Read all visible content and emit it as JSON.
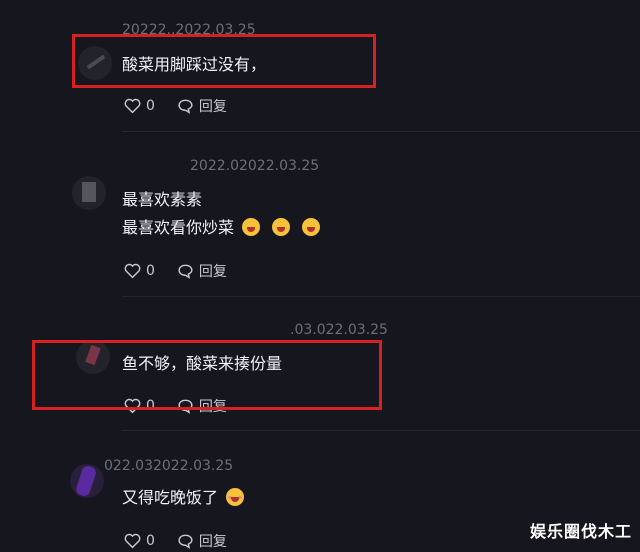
{
  "comments": [
    {
      "meta": "20222..2022.03.25",
      "lines": [
        "酸菜用脚踩过没有，"
      ],
      "likes": "0",
      "reply": "回复"
    },
    {
      "meta": "2022.02022.03.25",
      "lines": [
        "最喜欢素素",
        "最喜欢看你炒菜"
      ],
      "likes": "0",
      "reply": "回复"
    },
    {
      "meta": ".03.022.03.25",
      "lines": [
        "鱼不够，酸菜来揍份量"
      ],
      "likes": "0",
      "reply": "回复"
    },
    {
      "meta": "022.032022.03.25",
      "lines": [
        "又得吃晚饭了"
      ],
      "likes": "0",
      "reply": "回复"
    }
  ],
  "watermark": "娱乐圈伐木工",
  "colors": {
    "background": "#16161e",
    "highlight": "#d62121",
    "meta": "#6f6f7a"
  },
  "icons": [
    "heart-icon",
    "comment-bubble-icon",
    "emoji-icon"
  ]
}
